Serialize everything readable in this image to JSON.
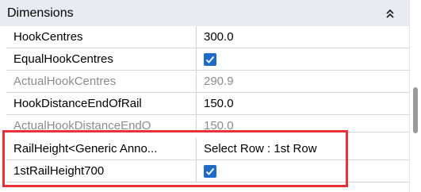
{
  "section": {
    "title": "Dimensions",
    "collapse_icon": "double-chevron-up-icon"
  },
  "rows": [
    {
      "name": "HookCentres",
      "value": "300.0",
      "type": "text",
      "editable": true
    },
    {
      "name": "EqualHookCentres",
      "value": "checked",
      "type": "checkbox",
      "editable": true
    },
    {
      "name": "ActualHookCentres",
      "value": "290.9",
      "type": "text",
      "editable": false
    },
    {
      "name": "HookDistanceEndOfRail",
      "value": "150.0",
      "type": "text",
      "editable": true
    },
    {
      "name": "ActualHookDistanceEndO",
      "value": "150.0",
      "type": "text",
      "editable": false
    },
    {
      "name": "RailHeight<Generic Anno...",
      "value": "Select Row : 1st Row",
      "type": "text",
      "editable": true
    },
    {
      "name": "1stRailHeight700",
      "value": "checked",
      "type": "checkbox",
      "editable": true
    }
  ],
  "colors": {
    "accent": "#1f6bc6",
    "highlight": "#e8323a",
    "header_bg": "#e8ecf1",
    "disabled_text": "#8c8c8c"
  }
}
